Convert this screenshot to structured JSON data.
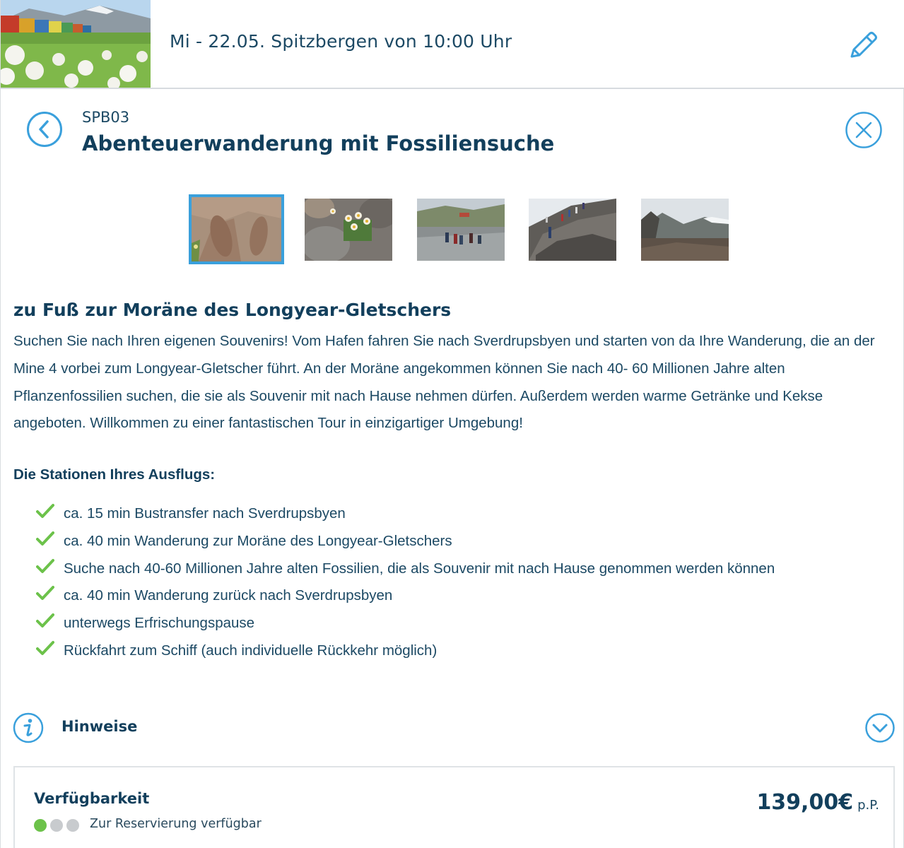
{
  "header": {
    "title": "Mi - 22.05. Spitzbergen von 10:00 Uhr"
  },
  "excursion": {
    "code": "SPB03",
    "title": "Abenteuerwanderung mit Fossiliensuche",
    "gallery": [
      {
        "name": "fossil"
      },
      {
        "name": "flowers"
      },
      {
        "name": "group-valley"
      },
      {
        "name": "hikers-slope"
      },
      {
        "name": "landscape"
      }
    ],
    "subtitle": "zu Fuß zur Moräne des Longyear-Gletschers",
    "description": "Suchen Sie nach Ihren eigenen Souvenirs! Vom Hafen fahren Sie nach Sverdrupsbyen und starten von da Ihre Wanderung, die an der Mine 4 vorbei zum Longyear-Gletscher führt. An der Moräne angekommen können Sie nach 40- 60 Millionen Jahre alten Pflanzenfossilien suchen, die sie als Souvenir mit nach Hause nehmen dürfen. Außerdem werden warme Getränke und Kekse angeboten. Willkommen zu einer fantastischen Tour in einzigartiger Umgebung!",
    "stations_title": "Die Stationen Ihres Ausflugs:",
    "stations": [
      "ca. 15 min Bustransfer nach Sverdrupsbyen",
      "ca. 40 min Wanderung zur Moräne des Longyear-Gletschers",
      "Suche nach 40-60 Millionen Jahre alten Fossilien, die als Souvenir mit nach Hause genommen werden können",
      "ca. 40 min Wanderung zurück nach Sverdrupsbyen",
      "unterwegs Erfrischungspause",
      "Rückfahrt zum Schiff (auch individuelle Rückkehr möglich)"
    ]
  },
  "hinweise": {
    "label": "Hinweise"
  },
  "availability": {
    "title": "Verfügbarkeit",
    "status_text": "Zur Reservierung verfügbar",
    "level_filled": 1,
    "level_total": 3,
    "price": "139,00€",
    "price_unit": "p.P."
  },
  "colors": {
    "primary": "#123f5c",
    "accent": "#3aa0dc",
    "check": "#6cc24a"
  }
}
